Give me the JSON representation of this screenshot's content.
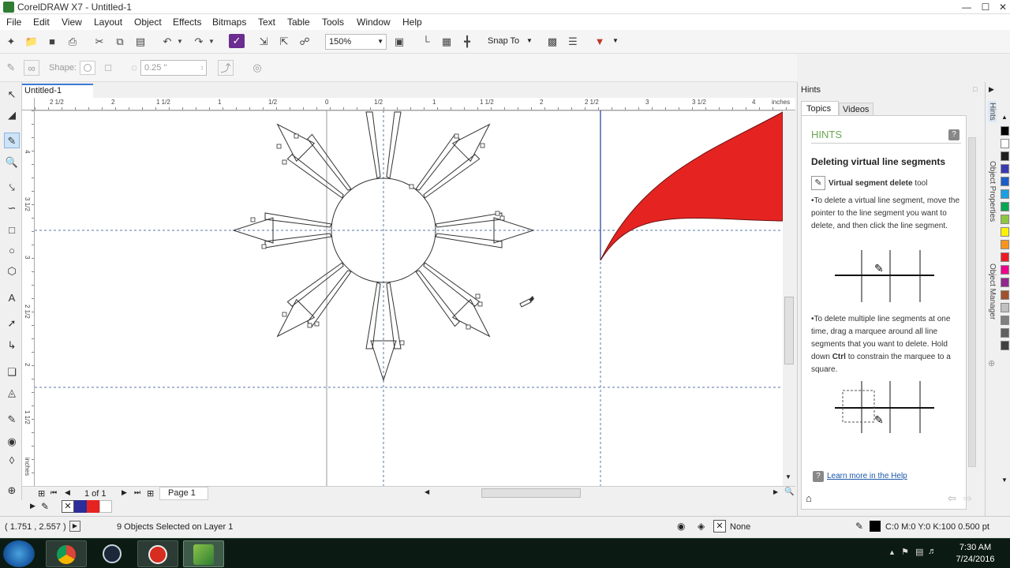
{
  "window": {
    "title": "CorelDRAW X7 - Untitled-1",
    "min": "—",
    "max": "☐",
    "close": "✕"
  },
  "menu": [
    "File",
    "Edit",
    "View",
    "Layout",
    "Object",
    "Effects",
    "Bitmaps",
    "Text",
    "Table",
    "Tools",
    "Window",
    "Help"
  ],
  "toolbar": {
    "zoom": "150%",
    "snap_to": "Snap To"
  },
  "propertybar": {
    "shape_label": "Shape:",
    "outline_width": "0.25 \""
  },
  "document": {
    "tab": "Untitled-1"
  },
  "rulers": {
    "units": "inches",
    "h_ticks": [
      "2 1/2",
      "2",
      "1 1/2",
      "1",
      "1/2",
      "0",
      "1/2",
      "1",
      "1 1/2",
      "2",
      "2 1/2",
      "3",
      "3 1/2",
      "4"
    ],
    "v_ticks": [
      "4",
      "3 1/2",
      "3",
      "2 1/2",
      "2",
      "1 1/2",
      "inches"
    ]
  },
  "page_nav": {
    "current": "1 of 1",
    "page_tab": "Page 1"
  },
  "status": {
    "coords": "( 1.751 , 2.557 )",
    "selection": "9 Objects Selected on Layer 1",
    "fill_none": "None",
    "outline_info": "C:0 M:0 Y:0 K:100  0.500 pt"
  },
  "hints": {
    "panel_title": "Hints",
    "tabs": [
      "Topics",
      "Videos"
    ],
    "heading": "HINTS",
    "topic_title": "Deleting virtual line segments",
    "tool_name": "Virtual segment delete",
    "tool_suffix": " tool",
    "para1": "•To delete a virtual line segment, move the pointer to the line segment you want to delete, and then click the line segment.",
    "para2_a": "•To delete multiple line segments at one time, drag a marquee around all line segments that you want to delete. Hold down ",
    "para2_key": "Ctrl",
    "para2_b": " to constrain the marquee to a square.",
    "link": "Learn more in the Help"
  },
  "side_tabs": [
    "Hints",
    "Object Properties",
    "Object Manager"
  ],
  "colors": {
    "red_shape": "#e52421",
    "accent": "#3a7bd5"
  },
  "palette_colors": [
    "#000000",
    "#ffffff",
    "#1f1f1f",
    "#3a3ab0",
    "#1c5ec7",
    "#1aa0e0",
    "#00a651",
    "#8dc63f",
    "#fff200",
    "#f7941d",
    "#ed1c24",
    "#ec008c",
    "#92278f",
    "#a0522d",
    "#c0c0c0",
    "#808080",
    "#606060",
    "#404040"
  ],
  "clock": {
    "time": "7:30 AM",
    "date": "7/24/2016"
  }
}
